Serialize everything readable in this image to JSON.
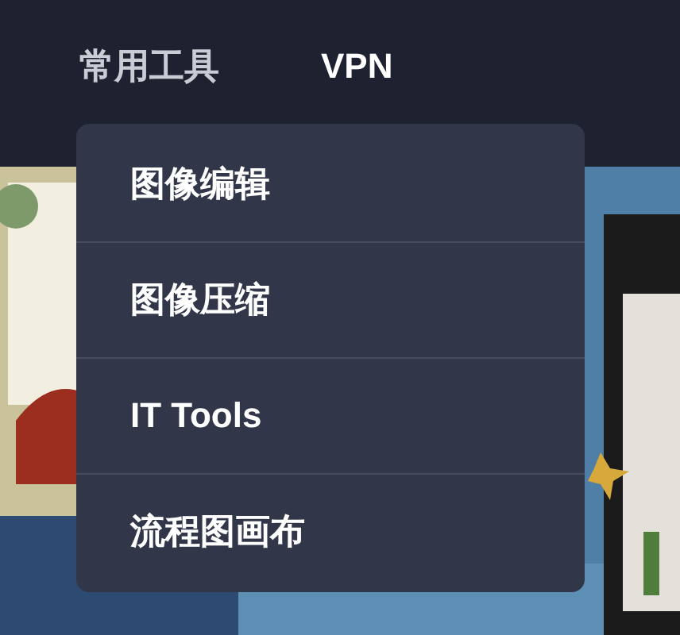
{
  "nav": {
    "items": [
      {
        "label": "常用工具",
        "selected": true
      },
      {
        "label": "VPN",
        "selected": false
      }
    ]
  },
  "dropdown": {
    "items": [
      {
        "label": "图像编辑"
      },
      {
        "label": "图像压缩"
      },
      {
        "label": "IT Tools"
      },
      {
        "label": "流程图画布"
      }
    ]
  }
}
